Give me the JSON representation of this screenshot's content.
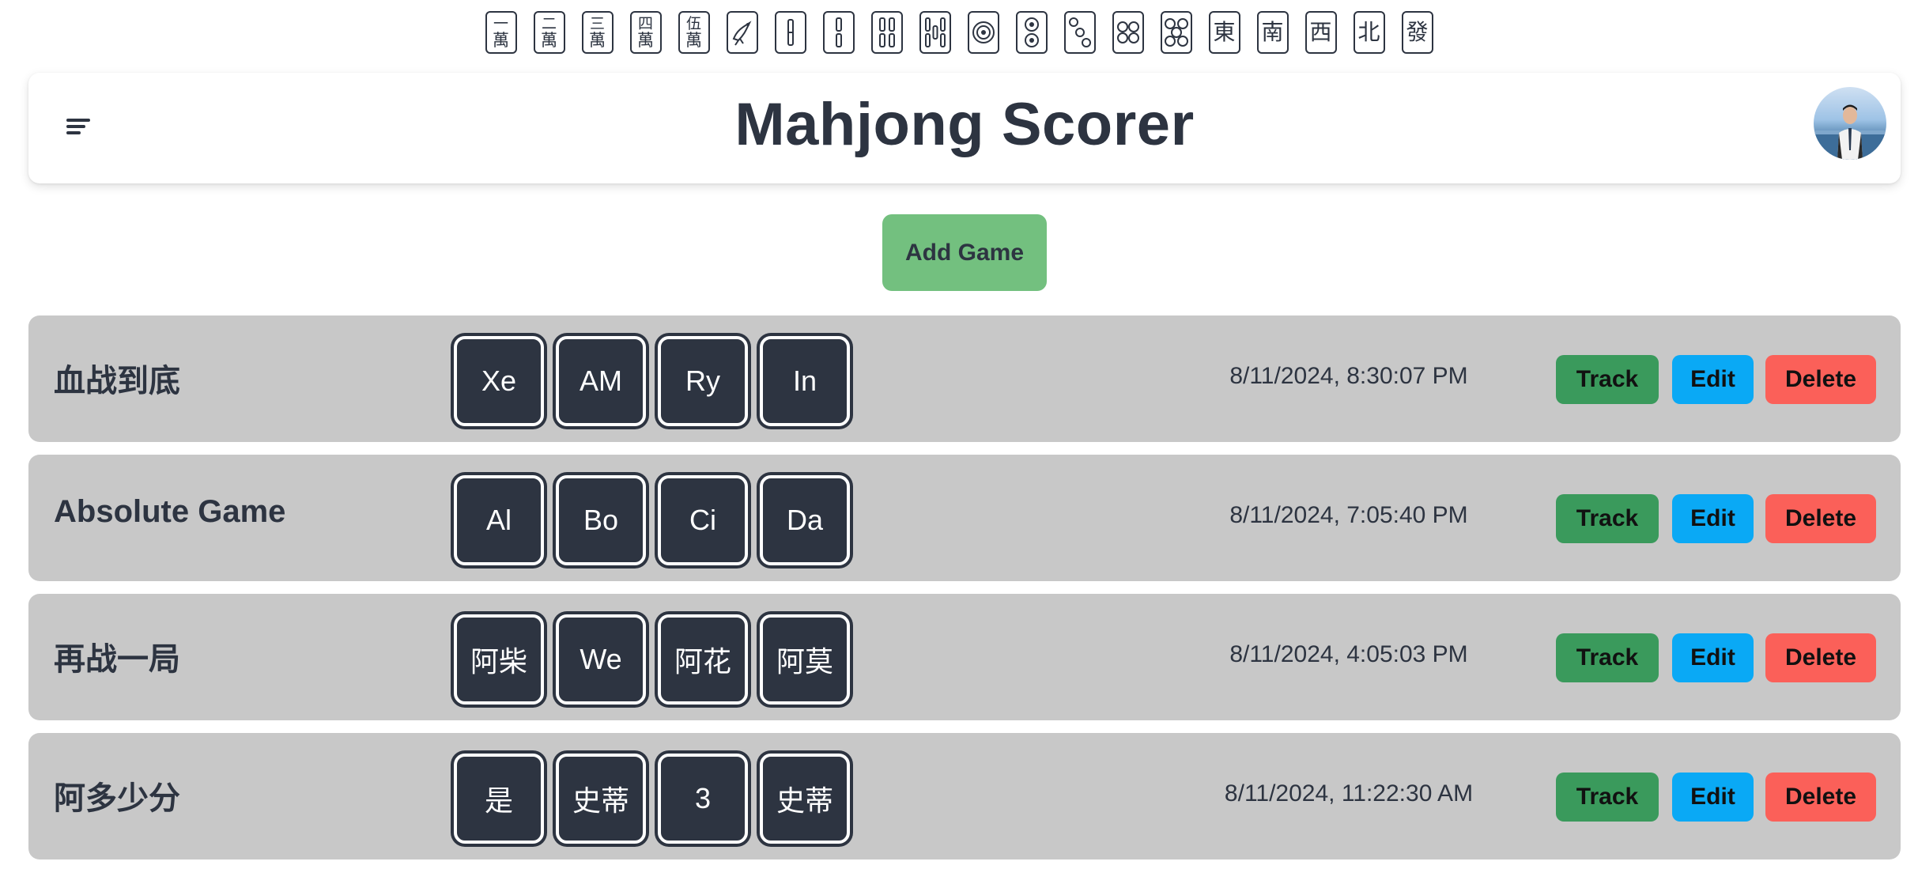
{
  "tiles": [
    {
      "type": "man",
      "top": "一",
      "bottom": "萬",
      "name": "1-man-tile"
    },
    {
      "type": "man",
      "top": "二",
      "bottom": "萬",
      "name": "2-man-tile"
    },
    {
      "type": "man",
      "top": "三",
      "bottom": "萬",
      "name": "3-man-tile"
    },
    {
      "type": "man",
      "top": "四",
      "bottom": "萬",
      "name": "4-man-tile"
    },
    {
      "type": "man",
      "top": "伍",
      "bottom": "萬",
      "name": "5-man-tile"
    },
    {
      "type": "icon",
      "name": "1-sou-bird-tile"
    },
    {
      "type": "icon",
      "name": "1-sou-tile"
    },
    {
      "type": "icon",
      "name": "2-sou-tile"
    },
    {
      "type": "icon",
      "name": "4-sou-tile"
    },
    {
      "type": "icon",
      "name": "5-sou-tile"
    },
    {
      "type": "icon",
      "name": "1-pin-tile"
    },
    {
      "type": "icon",
      "name": "2-pin-tile"
    },
    {
      "type": "icon",
      "name": "3-pin-tile"
    },
    {
      "type": "icon",
      "name": "4-pin-tile"
    },
    {
      "type": "icon",
      "name": "5-pin-tile"
    },
    {
      "type": "char",
      "text": "東",
      "name": "east-wind-tile"
    },
    {
      "type": "char",
      "text": "南",
      "name": "south-wind-tile"
    },
    {
      "type": "char",
      "text": "西",
      "name": "west-wind-tile"
    },
    {
      "type": "char",
      "text": "北",
      "name": "north-wind-tile"
    },
    {
      "type": "char",
      "text": "發",
      "name": "green-dragon-tile"
    }
  ],
  "header": {
    "title": "Mahjong Scorer",
    "menu_icon": "menu-icon",
    "avatar": "user-avatar"
  },
  "add_game_label": "Add Game",
  "games": [
    {
      "name": "血战到底",
      "players": [
        "Xe",
        "AM",
        "Ry",
        "In"
      ],
      "date": "8/11/2024, 8:30:07 PM"
    },
    {
      "name": "Absolute Game",
      "players": [
        "Al",
        "Bo",
        "Ci",
        "Da"
      ],
      "date": "8/11/2024, 7:05:40 PM"
    },
    {
      "name": "再战一局",
      "players": [
        "阿柴",
        "We",
        "阿花",
        "阿莫"
      ],
      "date": "8/11/2024, 4:05:03 PM"
    },
    {
      "name": "阿多少分",
      "players": [
        "是",
        "史蒂",
        "3",
        "史蒂"
      ],
      "date": "8/11/2024, 11:22:30 AM"
    }
  ],
  "actions": {
    "track": "Track",
    "edit": "Edit",
    "delete": "Delete"
  },
  "colors": {
    "text": "#2d3441",
    "row_bg": "#c8c8c8",
    "add_game": "#73c07f",
    "track": "#3a9a5c",
    "edit": "#0aa9f5",
    "delete": "#fb6059"
  }
}
